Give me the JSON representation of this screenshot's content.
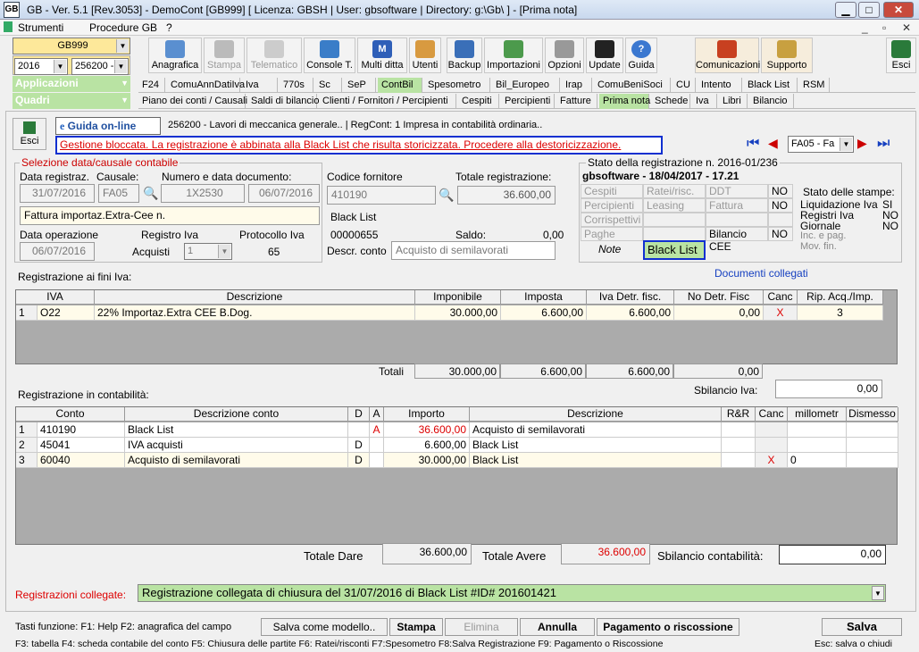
{
  "title": "GB - Ver. 5.1 [Rev.3053] - DemoCont [GB999]     [ Licenza: GBSH | User: gbsoftware | Directory: g:\\Gb\\ ] - [Prima nota]",
  "menu": [
    "Strumenti",
    "Procedure GB",
    "?"
  ],
  "company": "GB999",
  "year": "2016",
  "ente": "256200 -",
  "toolbar": [
    "Anagrafica",
    "Stampa",
    "Telematico",
    "Console T.",
    "Multi ditta",
    "Utenti",
    "Backup",
    "Importazioni",
    "Opzioni",
    "Update",
    "Guida",
    "Comunicazioni",
    "Supporto",
    "Esci"
  ],
  "applicazioni": "Applicazioni",
  "quadri": "Quadri",
  "tabs1": [
    "F24",
    "ComuAnnDatiIva",
    "Iva",
    "770s",
    "Sc",
    "SeP",
    "ContBil",
    "Spesometro",
    "Bil_Europeo",
    "Irap",
    "ComuBeniSoci",
    "CU",
    "Intento",
    "Black List",
    "RSM"
  ],
  "tabs2": [
    "Piano dei conti / Causali",
    "Saldi di bilancio",
    "Clienti / Fornitori / Percipienti",
    "Cespiti",
    "Percipienti",
    "Fatture",
    "Prima nota",
    "Schede",
    "Iva",
    "Libri",
    "Bilancio"
  ],
  "esci": "Esci",
  "guida": "Guida on-line",
  "info": "256200 - Lavori di meccanica generale.. | RegCont: 1 Impresa  in contabilità ordinaria..",
  "warning": "Gestione bloccata. La registrazione è abbinata alla Black List che risulta storicizzata. Procedere alla destoricizzazione.",
  "causale_nav": "FA05 - Fa",
  "sel": {
    "title": "Selezione data/causale contabile",
    "l_data": "Data registraz.",
    "l_caus": "Causale:",
    "l_num": "Numero e data documento:",
    "data": "31/07/2016",
    "caus": "FA05",
    "num": "1X2530",
    "datadoc": "06/07/2016",
    "descr": "Fattura importaz.Extra-Cee n.",
    "l_dataop": "Data operazione",
    "l_reg": "Registro Iva",
    "l_prot": "Protocollo Iva",
    "dataop": "06/07/2016",
    "reg": "Acquisti",
    "regn": "1",
    "prot": "65"
  },
  "forn": {
    "l_cod": "Codice fornitore",
    "cod": "410190",
    "l_tot": "Totale registrazione:",
    "tot": "36.600,00",
    "nome": "Black List",
    "code2": "00000655",
    "l_saldo": "Saldo:",
    "saldo": "0,00",
    "l_descr": "Descr. conto",
    "descr": "Acquisto di semilavorati"
  },
  "stato": {
    "title": "Stato della registrazione n. 2016-01/236",
    "sub": "gbsoftware - 18/04/2017 - 17.21",
    "cells": [
      "Cespiti",
      "Ratei/risc.",
      "DDT",
      "NO",
      "Percipienti",
      "Leasing",
      "Fattura",
      "NO",
      "Corrispettivi",
      "",
      "",
      "",
      "Paghe",
      "",
      "Bilancio CEE",
      "NO"
    ],
    "note": "Note",
    "bl": "Black List",
    "stampe_title": "Stato delle stampe:",
    "stampe": [
      [
        "Liquidazione Iva",
        "SI"
      ],
      [
        "Registri Iva",
        "NO"
      ],
      [
        "Giornale",
        "NO"
      ],
      [
        "Inc. e pag.",
        ""
      ],
      [
        "Mov. fin.",
        ""
      ]
    ]
  },
  "iva": {
    "title": "Registrazione ai fini Iva:",
    "doc": "Documenti collegati",
    "headers": [
      "IVA",
      "Descrizione",
      "Imponibile",
      "Imposta",
      "Iva Detr. fisc.",
      "No Detr. Fisc",
      "Canc",
      "Rip. Acq./Imp."
    ],
    "row": [
      "1",
      "O22",
      "22% Importaz.Extra CEE B.Dog.",
      "30.000,00",
      "6.600,00",
      "6.600,00",
      "0,00",
      "X",
      "3"
    ],
    "totali": "Totali",
    "tot": [
      "30.000,00",
      "6.600,00",
      "6.600,00",
      "0,00"
    ],
    "l_sbil": "Sbilancio Iva:",
    "sbil": "0,00"
  },
  "cont": {
    "title": "Registrazione in contabilità:",
    "headers": [
      "Conto",
      "Descrizione conto",
      "D",
      "A",
      "Importo",
      "Descrizione",
      "R&R",
      "Canc",
      "millometr",
      "Dismesso"
    ],
    "rows": [
      [
        "1",
        "410190",
        "Black List",
        "",
        "A",
        "36.600,00",
        "Acquisto di semilavorati",
        "",
        "",
        ""
      ],
      [
        "2",
        "45041",
        "IVA acquisti",
        "D",
        "",
        "6.600,00",
        "Black List",
        "",
        "",
        ""
      ],
      [
        "3",
        "60040",
        "Acquisto di semilavorati",
        "D",
        "",
        "30.000,00",
        "Black List",
        "",
        "X",
        "0"
      ]
    ],
    "l_dare": "Totale Dare",
    "dare": "36.600,00",
    "l_avere": "Totale Avere",
    "avere": "36.600,00",
    "l_sbil": "Sbilancio contabilità:",
    "sbil": "0,00"
  },
  "coll": {
    "label": "Registrazioni collegate:",
    "value": "Registrazione collegata di chiusura del 31/07/2016 di Black List  #ID# 201601421"
  },
  "footer": {
    "keys1": "Tasti funzione: F1: Help  F2: anagrafica del campo",
    "salva_mod": "Salva come modello..",
    "stampa": "Stampa",
    "elimina": "Elimina",
    "annulla": "Annulla",
    "pagamento": "Pagamento o riscossione",
    "salva": "Salva",
    "keys2": "F3: tabella   F4: scheda contabile del conto  F5: Chiusura delle partite       F6: Ratei/risconti   F7:Spesometro  F8:Salva Registrazione      F9: Pagamento o Riscossione",
    "esc": "Esc: salva o chiudi"
  }
}
